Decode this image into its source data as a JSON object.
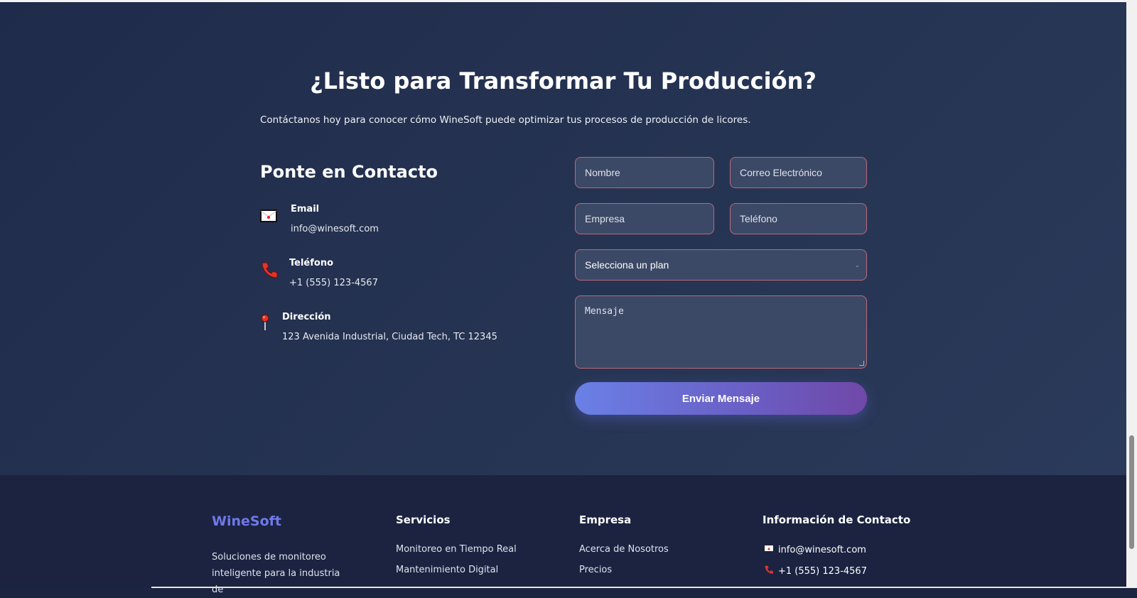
{
  "hero": {
    "title": "¿Listo para Transformar Tu Producción?",
    "subtitle": "Contáctanos hoy para conocer cómo WineSoft puede optimizar tus procesos de producción de licores."
  },
  "contact_info": {
    "heading": "Ponte en Contacto",
    "items": [
      {
        "icon": "envelope-icon",
        "title": "Email",
        "value": "info@winesoft.com"
      },
      {
        "icon": "phone-icon",
        "title": "Teléfono",
        "value": "+1 (555) 123-4567"
      },
      {
        "icon": "pin-icon",
        "title": "Dirección",
        "value": "123 Avenida Industrial, Ciudad Tech, TC 12345"
      }
    ]
  },
  "form": {
    "name_placeholder": "Nombre",
    "email_placeholder": "Correo Electrónico",
    "company_placeholder": "Empresa",
    "phone_placeholder": "Teléfono",
    "plan_selected": "Selecciona un plan",
    "message_placeholder": "Mensaje",
    "submit_label": "Enviar Mensaje"
  },
  "footer": {
    "brand": "WineSoft",
    "brand_description": "Soluciones de monitoreo inteligente para la industria de",
    "columns": [
      {
        "title": "Servicios",
        "links": [
          "Monitoreo en Tiempo Real",
          "Mantenimiento Digital"
        ]
      },
      {
        "title": "Empresa",
        "links": [
          "Acerca de Nosotros",
          "Precios"
        ]
      }
    ],
    "contact": {
      "title": "Información de Contacto",
      "email": "info@winesoft.com",
      "phone": "+1 (555) 123-4567"
    }
  },
  "colors": {
    "section_bg": "#263453",
    "footer_bg": "#1b2341",
    "field_bg": "#3c4966",
    "field_border": "#b76a7a",
    "brand": "#6f79e8",
    "button_start": "#6a80e6",
    "button_end": "#7048a8"
  }
}
